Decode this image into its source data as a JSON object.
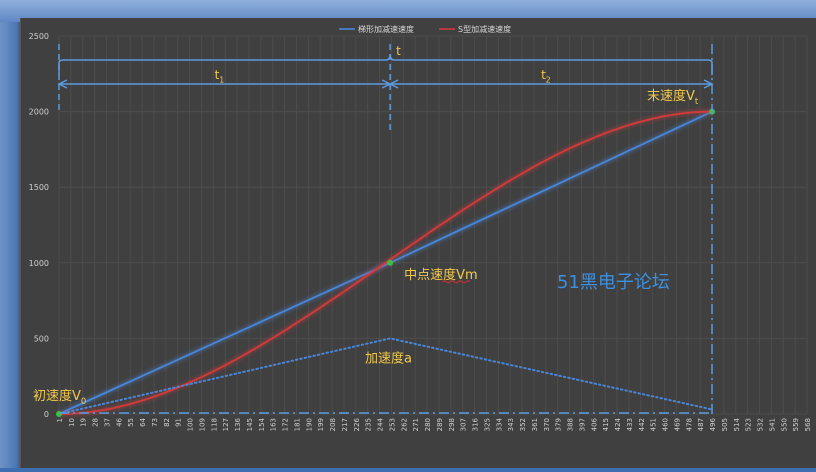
{
  "chart_data": {
    "type": "line",
    "legend": {
      "position": "top",
      "entries": [
        "梯形加减速速度",
        "S型加减速速度"
      ]
    },
    "series": [
      {
        "name": "梯形加减速速度",
        "color": "#4a86d8",
        "x": [
          1,
          252,
          496
        ],
        "y": [
          0,
          1000,
          2000
        ]
      },
      {
        "name": "S型加减速速度",
        "color": "#d23a3a",
        "shape": "s-curve",
        "x": [
          1,
          252,
          496
        ],
        "y": [
          0,
          1000,
          2000
        ]
      },
      {
        "name": "加速度a",
        "color": "#4a86d8",
        "style": "dotted",
        "x": [
          1,
          252,
          496
        ],
        "y": [
          0,
          500,
          30
        ]
      }
    ],
    "x_ticks": [
      1,
      10,
      19,
      28,
      37,
      46,
      55,
      64,
      73,
      82,
      91,
      100,
      109,
      118,
      127,
      136,
      145,
      154,
      163,
      172,
      181,
      190,
      199,
      208,
      217,
      226,
      235,
      244,
      253,
      262,
      271,
      280,
      289,
      298,
      307,
      316,
      325,
      334,
      343,
      352,
      361,
      370,
      379,
      388,
      397,
      406,
      415,
      424,
      433,
      442,
      451,
      460,
      469,
      478,
      487,
      496,
      505,
      514,
      523,
      532,
      541,
      550,
      559,
      568
    ],
    "y_ticks": [
      0,
      500,
      1000,
      1500,
      2000,
      2500
    ],
    "ylim": [
      0,
      2500
    ],
    "xlim": [
      1,
      568
    ],
    "grid": true,
    "annotations": {
      "t_label": "t",
      "t1_label": "t",
      "t1_sub": "1",
      "t2_label": "t",
      "t2_sub": "2",
      "v0_label": "初速度V",
      "v0_sub": "0",
      "vm_label": "中点速度Vm",
      "vt_label": "末速度V",
      "vt_sub": "t",
      "accel_label": "加速度a",
      "watermark": "51黑电子论坛"
    },
    "colors": {
      "label": "#f2c94c",
      "dim": "#5b9be0",
      "watermark": "#3d8fe0",
      "tick": "#cfcfcf",
      "grid": "#4d4d4d",
      "marker": "#3fbf3f"
    }
  }
}
